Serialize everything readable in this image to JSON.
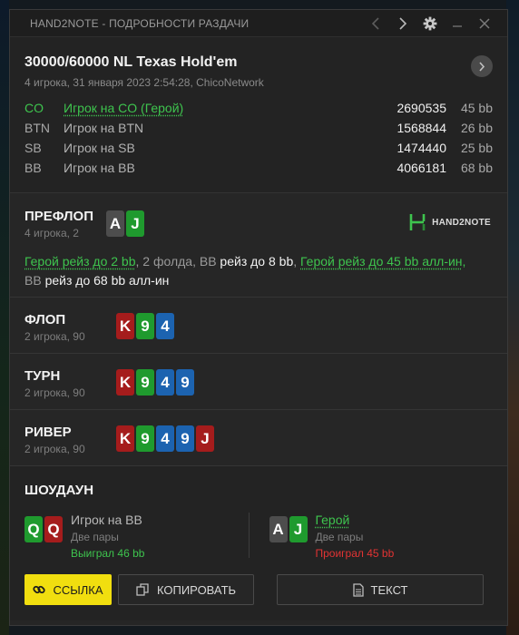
{
  "window": {
    "title": "HAND2NOTE - ПОДРОБНОСТИ РАЗДАЧИ"
  },
  "game": {
    "title": "30000/60000 NL Texas Hold'em",
    "subtitle": "4 игрока, 31 января 2023 2:54:28, ChicoNetwork"
  },
  "players": [
    {
      "pos": "CO",
      "name": "Игрок на CO (Герой)",
      "stack": "2690535",
      "bb": "45 bb"
    },
    {
      "pos": "BTN",
      "name": "Игрок на BTN",
      "stack": "1568844",
      "bb": "26 bb"
    },
    {
      "pos": "SB",
      "name": "Игрок на SB",
      "stack": "1474440",
      "bb": "25 bb"
    },
    {
      "pos": "BB",
      "name": "Игрок на BB",
      "stack": "4066181",
      "bb": "68 bb"
    }
  ],
  "preflop": {
    "name": "ПРЕФЛОП",
    "sub": "4 игрока, 2",
    "hero_cards": [
      "A",
      "J"
    ],
    "logo": "HAND2NOTE",
    "actions": {
      "a1": "Герой рейз до 2 bb",
      "a2": ", 2 фолда, BB",
      "a3": " рейз до 8 bb",
      "a4": ", ",
      "a5": "Герой рейз до 45 bb алл-ин",
      "a6": ",",
      "a7": "BB",
      "a8": " рейз до 68 bb алл-ин"
    }
  },
  "flop": {
    "name": "ФЛОП",
    "sub": "2 игрока, 90",
    "cards": [
      "K",
      "9",
      "4"
    ]
  },
  "turn": {
    "name": "ТУРН",
    "sub": "2 игрока, 90",
    "cards": [
      "K",
      "9",
      "4",
      "9"
    ]
  },
  "river": {
    "name": "РИВЕР",
    "sub": "2 игрока, 90",
    "cards": [
      "K",
      "9",
      "4",
      "9",
      "J"
    ]
  },
  "showdown": {
    "name": "ШОУДАУН",
    "villain": {
      "cards": [
        "Q",
        "Q"
      ],
      "name": "Игрок на BB",
      "hand": "Две пары",
      "result": "Выиграл 46 bb"
    },
    "hero": {
      "cards": [
        "A",
        "J"
      ],
      "name": "Герой",
      "hand": "Две пары",
      "result": "Проиграл 45 bb"
    }
  },
  "buttons": {
    "link": "ССЫЛКА",
    "copy": "КОПИРОВАТЬ",
    "text": "ТЕКСТ"
  },
  "colors": {
    "hero_green": "#3ec44e",
    "loss_red": "#e23333",
    "accent_yellow": "#f1de0f",
    "card_spade": "#4d4d4d",
    "card_club": "#1f9a2e",
    "card_heart": "#a51c1c",
    "card_diamond": "#1c63b0"
  }
}
